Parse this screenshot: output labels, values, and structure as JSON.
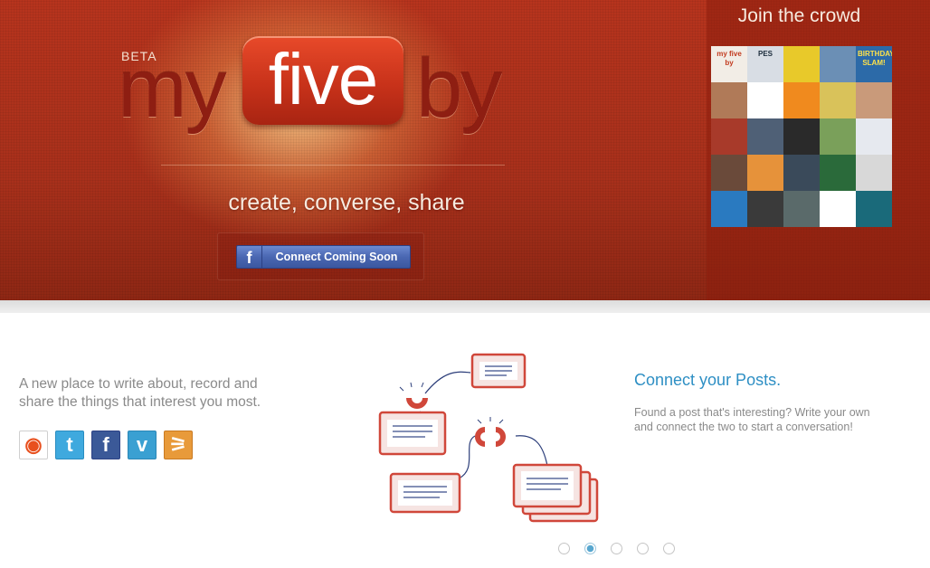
{
  "header": {
    "beta_label": "BETA",
    "logo": {
      "left": "my",
      "middle": "five",
      "right": "by"
    },
    "tagline": "create, converse, share",
    "connect_button": {
      "icon": "facebook-icon",
      "label": "Connect Coming Soon"
    }
  },
  "crowd": {
    "title": "Join the crowd",
    "avatars": [
      {
        "text": "my five by",
        "bg": "#f2ede6",
        "fg": "#c23a1e"
      },
      {
        "text": "PES",
        "bg": "#d8dde4",
        "fg": "#1a2a3a"
      },
      {
        "text": "",
        "bg": "#e8c92a",
        "fg": "#000"
      },
      {
        "text": "",
        "bg": "#6b8fb5",
        "fg": "#000"
      },
      {
        "text": "BIRTHDAY SLAM!",
        "bg": "#2c6aa8",
        "fg": "#ffe24a"
      },
      {
        "text": "",
        "bg": "#b07a58",
        "fg": "#000"
      },
      {
        "text": "",
        "bg": "#ffffff",
        "fg": "#000"
      },
      {
        "text": "",
        "bg": "#f08a1e",
        "fg": "#000"
      },
      {
        "text": "",
        "bg": "#d9c25a",
        "fg": "#000"
      },
      {
        "text": "",
        "bg": "#c99a7a",
        "fg": "#000"
      },
      {
        "text": "",
        "bg": "#a83a2a",
        "fg": "#000"
      },
      {
        "text": "",
        "bg": "#4f6076",
        "fg": "#000"
      },
      {
        "text": "",
        "bg": "#2a2a2a",
        "fg": "#000"
      },
      {
        "text": "",
        "bg": "#7aa05a",
        "fg": "#000"
      },
      {
        "text": "",
        "bg": "#e6e9ef",
        "fg": "#3a5aa0"
      },
      {
        "text": "",
        "bg": "#6a4a3a",
        "fg": "#000"
      },
      {
        "text": "",
        "bg": "#e6923a",
        "fg": "#000"
      },
      {
        "text": "",
        "bg": "#3a4a5a",
        "fg": "#000"
      },
      {
        "text": "",
        "bg": "#2a6a3a",
        "fg": "#000"
      },
      {
        "text": "",
        "bg": "#d8d8d8",
        "fg": "#222"
      },
      {
        "text": "",
        "bg": "#2a7ac0",
        "fg": "#000"
      },
      {
        "text": "",
        "bg": "#3a3a3a",
        "fg": "#000"
      },
      {
        "text": "",
        "bg": "#5a6a6a",
        "fg": "#000"
      },
      {
        "text": "",
        "bg": "#ffffff",
        "fg": "#000"
      },
      {
        "text": "",
        "bg": "#1a6a7a",
        "fg": "#000"
      }
    ]
  },
  "intro": {
    "text": "A new place to write about, record and share the things that interest you most."
  },
  "social": [
    {
      "name": "myfiveby-icon",
      "bg": "#ffffff",
      "border": "#cfcfcf",
      "glyph": "◉",
      "color": "#e8501e"
    },
    {
      "name": "twitter-icon",
      "bg": "#3fa9de",
      "border": "#2a8cc0",
      "glyph": "t",
      "color": "#ffffff"
    },
    {
      "name": "facebook-icon",
      "bg": "#3b5998",
      "border": "#2c4184",
      "glyph": "f",
      "color": "#ffffff"
    },
    {
      "name": "vimeo-icon",
      "bg": "#3aa0d2",
      "border": "#2a86b6",
      "glyph": "v",
      "color": "#ffffff"
    },
    {
      "name": "rss-icon",
      "bg": "#e89a3a",
      "border": "#c97a22",
      "glyph": "⚞",
      "color": "#ffffff"
    }
  ],
  "feature": {
    "title": "Connect your Posts.",
    "text": "Found a post that's interesting? Write your own and connect the two to start a conversation!"
  },
  "pager": {
    "count": 5,
    "active_index": 1
  },
  "colors": {
    "hero": "#a8301b",
    "accent_blue": "#2e8fc4",
    "text_gray": "#8a8a8a"
  }
}
